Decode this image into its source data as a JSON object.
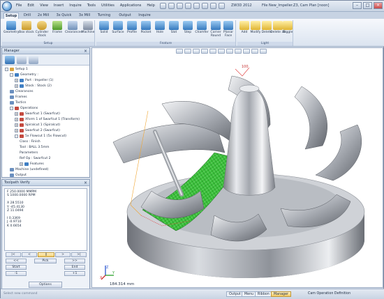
{
  "app": {
    "window_title": "ZW3D 2012",
    "file_title": "File New_Impeller.Z3, Cam Plan [noon]",
    "menu": [
      "File",
      "Edit",
      "View",
      "Insert",
      "Inquire",
      "Tools",
      "Utilities",
      "Applications",
      "Help"
    ]
  },
  "ribbon": {
    "tabs": [
      "Setup",
      "Drill",
      "2x Mill",
      "3x Quick",
      "3x Mill",
      "Turning",
      "Output",
      "Inquire"
    ],
    "active_tab": "Setup",
    "groups": [
      {
        "label": "Setup",
        "buttons": [
          "Geometry",
          "Box stock",
          "Cylinder stock",
          "Frame",
          "Clearances",
          "Machine"
        ]
      },
      {
        "label": "Feature",
        "buttons": [
          "Solid",
          "Surface",
          "Profile",
          "Pocket",
          "Hole",
          "Slot",
          "Step",
          "Chamfer",
          "Corner Round",
          "Planar Face"
        ]
      },
      {
        "label": "Light",
        "buttons": [
          "Add",
          "Modify",
          "Delete",
          "Delete all",
          "Toggle"
        ]
      }
    ]
  },
  "manager": {
    "title": "Manager",
    "tree": [
      {
        "label": "Setup 1",
        "level": 0,
        "toggle": "-",
        "color": "#d9a441"
      },
      {
        "label": "Geometry :",
        "level": 1,
        "toggle": "-",
        "color": "#3f7fc4"
      },
      {
        "label": "Part : Impeller (1)",
        "level": 2,
        "toggle": "+",
        "color": "#3f7fc4"
      },
      {
        "label": "Stock : Stock (2)",
        "level": 2,
        "toggle": "+",
        "color": "#3f7fc4"
      },
      {
        "label": "Clearances",
        "level": 1,
        "toggle": "",
        "color": "#6a8fbf"
      },
      {
        "label": "Frames",
        "level": 1,
        "toggle": "",
        "color": "#6a8fbf"
      },
      {
        "label": "Tactics",
        "level": 1,
        "toggle": "",
        "color": "#6a8fbf"
      },
      {
        "label": "Operations",
        "level": 1,
        "toggle": "-",
        "color": "#c44a3f"
      },
      {
        "label": "Swarfcut 1 (Swarfcut)",
        "level": 2,
        "toggle": "+",
        "color": "#c44a3f"
      },
      {
        "label": "Xform 1 of Swarfcut 1 (Transform)",
        "level": 2,
        "toggle": "+",
        "color": "#c44a3f"
      },
      {
        "label": "Spiralcut 1 (Spiralcut)",
        "level": 2,
        "toggle": "+",
        "color": "#c44a3f"
      },
      {
        "label": "Swarfcut 2 (Swarfcut)",
        "level": 2,
        "toggle": "+",
        "color": "#c44a3f"
      },
      {
        "label": "5x Flowcut 1 (5x Flowcut)",
        "level": 2,
        "toggle": "-",
        "color": "#c44a3f"
      },
      {
        "label": "Class : Finish",
        "level": 3,
        "toggle": "",
        "color": ""
      },
      {
        "label": "Tool : BALL 3.5mm",
        "level": 3,
        "toggle": "",
        "color": ""
      },
      {
        "label": "Parameters",
        "level": 3,
        "toggle": "",
        "color": ""
      },
      {
        "label": "Ref Op : Swarfcut 2",
        "level": 3,
        "toggle": "",
        "color": ""
      },
      {
        "label": "Features",
        "level": 3,
        "toggle": "+",
        "color": "#3f7fc4"
      },
      {
        "label": "Machine (undefined)",
        "level": 1,
        "toggle": "",
        "color": "#6a8fbf"
      },
      {
        "label": "Output",
        "level": 1,
        "toggle": "",
        "color": "#6a8fbf"
      }
    ]
  },
  "verify": {
    "title": "Toolpath Verify",
    "lines": [
      "F 250.0000 MMPM",
      "S 1000.0000 RPM",
      "",
      "X 28.5510",
      "Y -45.4130",
      "Z 11.0494",
      "",
      "I 0.3369",
      "J -0.9710",
      "K 0.6654"
    ],
    "buttons": {
      "first": "|<",
      "prev_big": "<",
      "mid": "||",
      "next_big": ">",
      "last": ">|",
      "back": "<<",
      "pick": "Pick",
      "forward": ">>",
      "start": "Start",
      "end": "End",
      "minus": "-1",
      "plus": "+1",
      "options": "Options"
    }
  },
  "viewport": {
    "scale_label": "184.314 mm",
    "annotation": "100",
    "axes": {
      "x": "X",
      "y": "Y",
      "z": "Z"
    }
  },
  "status": {
    "left_text": "Select new command",
    "tabs": [
      "Output",
      "Menu",
      "Ribbon",
      "Manager"
    ],
    "active_tab": "Manager",
    "message": "Cam Operation Definition"
  }
}
